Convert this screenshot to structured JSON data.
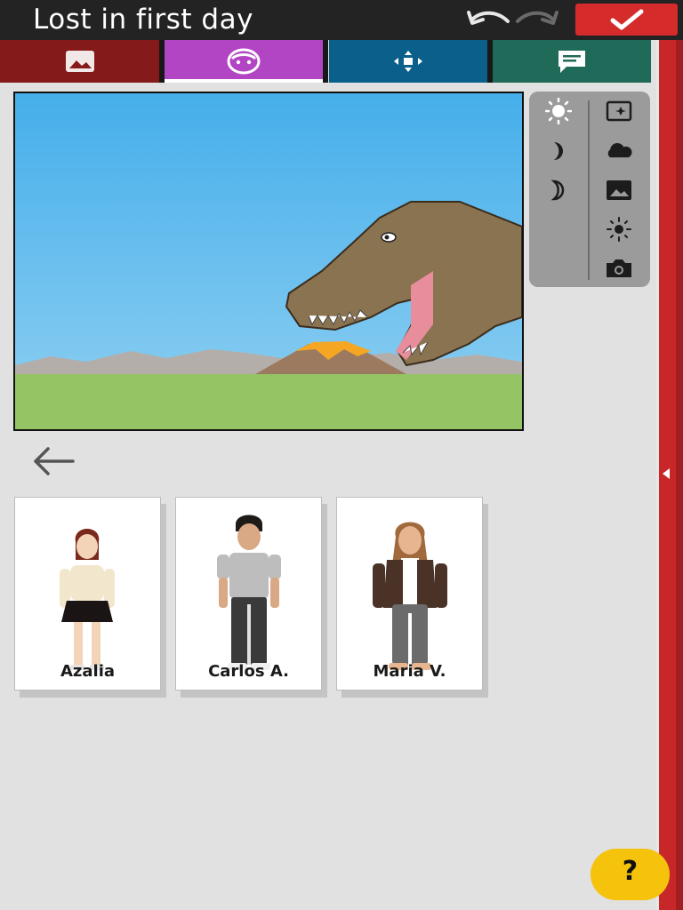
{
  "app": {
    "title": "Lost in first day",
    "help_label": "?"
  },
  "toolbar": {
    "undo_icon": "undo-icon",
    "redo_icon": "redo-icon",
    "done_icon": "checkmark-icon"
  },
  "tabs": [
    {
      "id": "scenes",
      "icon": "image-icon",
      "color": "#851a1a"
    },
    {
      "id": "characters",
      "icon": "face-icon",
      "color": "#b245c3",
      "active": true
    },
    {
      "id": "layout",
      "icon": "move-arrows-icon",
      "color": "#0b5f8b"
    },
    {
      "id": "text",
      "icon": "speech-bubble-icon",
      "color": "#1f6a58"
    }
  ],
  "filters": {
    "left": [
      "sun-icon",
      "moon-icon",
      "crescent-moon-icon"
    ],
    "right": [
      "sparkle-image-icon",
      "cloud-icon",
      "image-icon",
      "brightness-icon",
      "camera-icon"
    ]
  },
  "characters": [
    {
      "name": "Azalia"
    },
    {
      "name": "Carlos A."
    },
    {
      "name": "Maria V."
    }
  ],
  "colors": {
    "accent_red": "#d52b2b",
    "help_yellow": "#f5c20c",
    "sky": "#4bb0e8",
    "grass": "#94c463"
  }
}
